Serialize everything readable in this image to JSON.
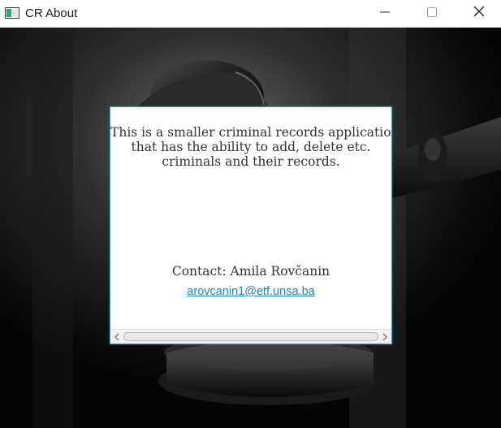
{
  "window": {
    "title": "CR About",
    "icon": "app-window-icon",
    "controls": {
      "minimize_icon": "minimize-icon",
      "maximize_icon": "maximize-icon",
      "close_icon": "close-icon"
    }
  },
  "about": {
    "description_lines": [
      "This is a smaller criminal records application",
      "that has the ability to add, delete etc.",
      "criminals and their records."
    ],
    "contact": "Contact: Amila Rovčanin",
    "email": "arovcanin1@etf.unsa.ba"
  },
  "scrollbar": {
    "left_icon": "chevron-left-icon",
    "right_icon": "chevron-right-icon"
  },
  "colors": {
    "panel_border": "#1ea1d4",
    "link": "#1a86b5",
    "text": "#333333"
  }
}
